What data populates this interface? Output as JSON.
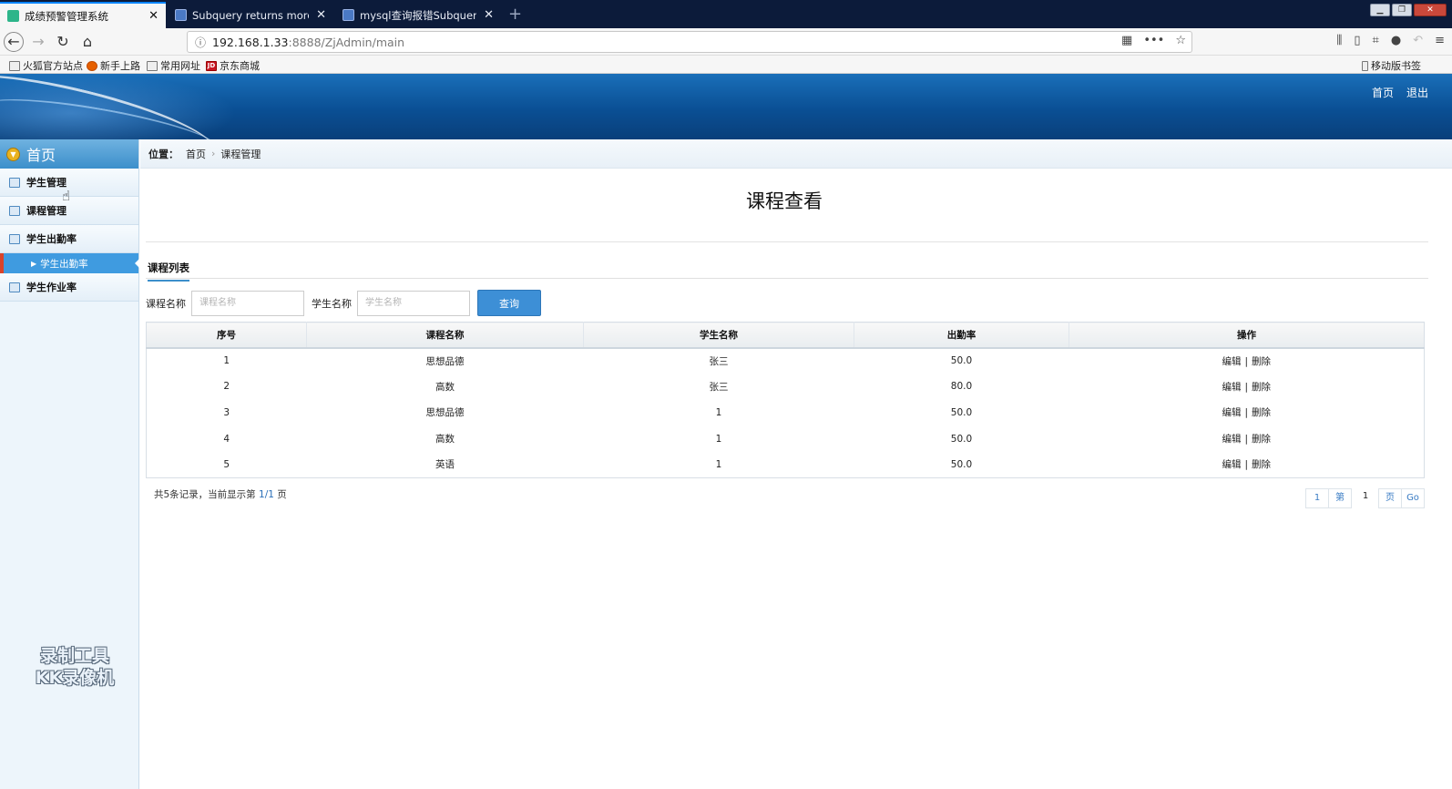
{
  "browser": {
    "tabs": [
      {
        "title": "成绩预警管理系统"
      },
      {
        "title": "Subquery returns more than"
      },
      {
        "title": "mysql查询报错Subquery retu"
      }
    ],
    "url_host": "192.168.1.33",
    "url_rest": ":8888/ZjAdmin/main",
    "bookmarks": [
      "火狐官方站点",
      "新手上路",
      "常用网址",
      "京东商城"
    ],
    "mobile_bookmarks": "移动版书签"
  },
  "header": {
    "nav": [
      "首页",
      "退出"
    ]
  },
  "sidebar": {
    "title": "首页",
    "items": [
      {
        "label": "学生管理"
      },
      {
        "label": "课程管理"
      },
      {
        "label": "学生出勤率"
      },
      {
        "label": "学生出勤率",
        "sub": true
      },
      {
        "label": "学生作业率"
      }
    ],
    "watermark_line1": "录制工具",
    "watermark_line2": "KK录像机"
  },
  "breadcrumb": {
    "prefix": "位置：",
    "home": "首页",
    "current": "课程管理"
  },
  "page": {
    "title": "课程查看",
    "list_tab": "课程列表"
  },
  "search": {
    "course_label": "课程名称",
    "course_placeholder": "课程名称",
    "student_label": "学生名称",
    "student_placeholder": "学生名称",
    "button": "查询"
  },
  "table": {
    "headers": [
      "序号",
      "课程名称",
      "学生名称",
      "出勤率",
      "操作"
    ],
    "rows": [
      {
        "no": "1",
        "course": "思想品德",
        "student": "张三",
        "rate": "50.0"
      },
      {
        "no": "2",
        "course": "高数",
        "student": "张三",
        "rate": "80.0"
      },
      {
        "no": "3",
        "course": "思想品德",
        "student": "1",
        "rate": "50.0"
      },
      {
        "no": "4",
        "course": "高数",
        "student": "1",
        "rate": "50.0"
      },
      {
        "no": "5",
        "course": "英语",
        "student": "1",
        "rate": "50.0"
      }
    ],
    "edit": "编辑",
    "sep": "|",
    "delete": "删除"
  },
  "footer": {
    "info_a": "共5条记录，当前显示第 ",
    "info_page": "1/1",
    "info_b": " 页",
    "pager": {
      "first": "1",
      "di": "第",
      "current": "1",
      "ye": "页",
      "go": "Go"
    }
  }
}
